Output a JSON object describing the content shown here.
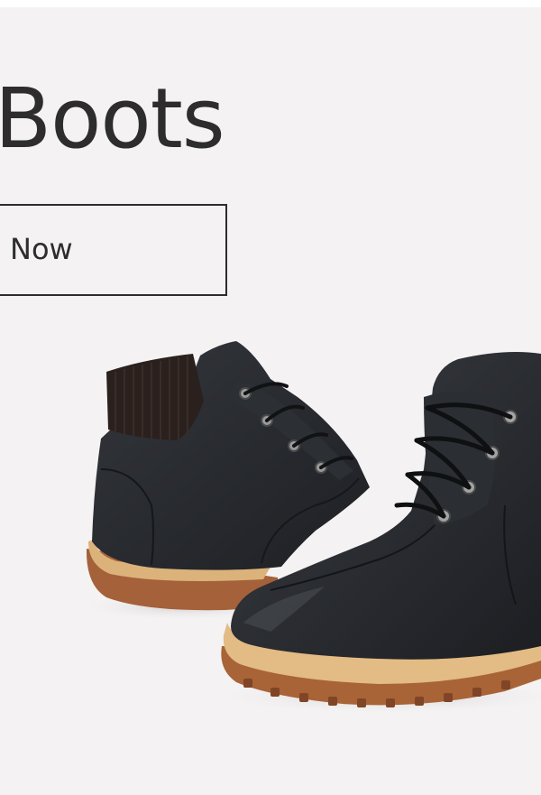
{
  "banner": {
    "headline": "Boots",
    "cta_label": "Now"
  },
  "colors": {
    "background": "#f4f2f3",
    "text": "#2d2d2d",
    "boot_leather": "#25272b",
    "boot_sole": "#b06a3c",
    "boot_welt": "#e0b87f"
  },
  "icons": {
    "product": "boots-image"
  }
}
